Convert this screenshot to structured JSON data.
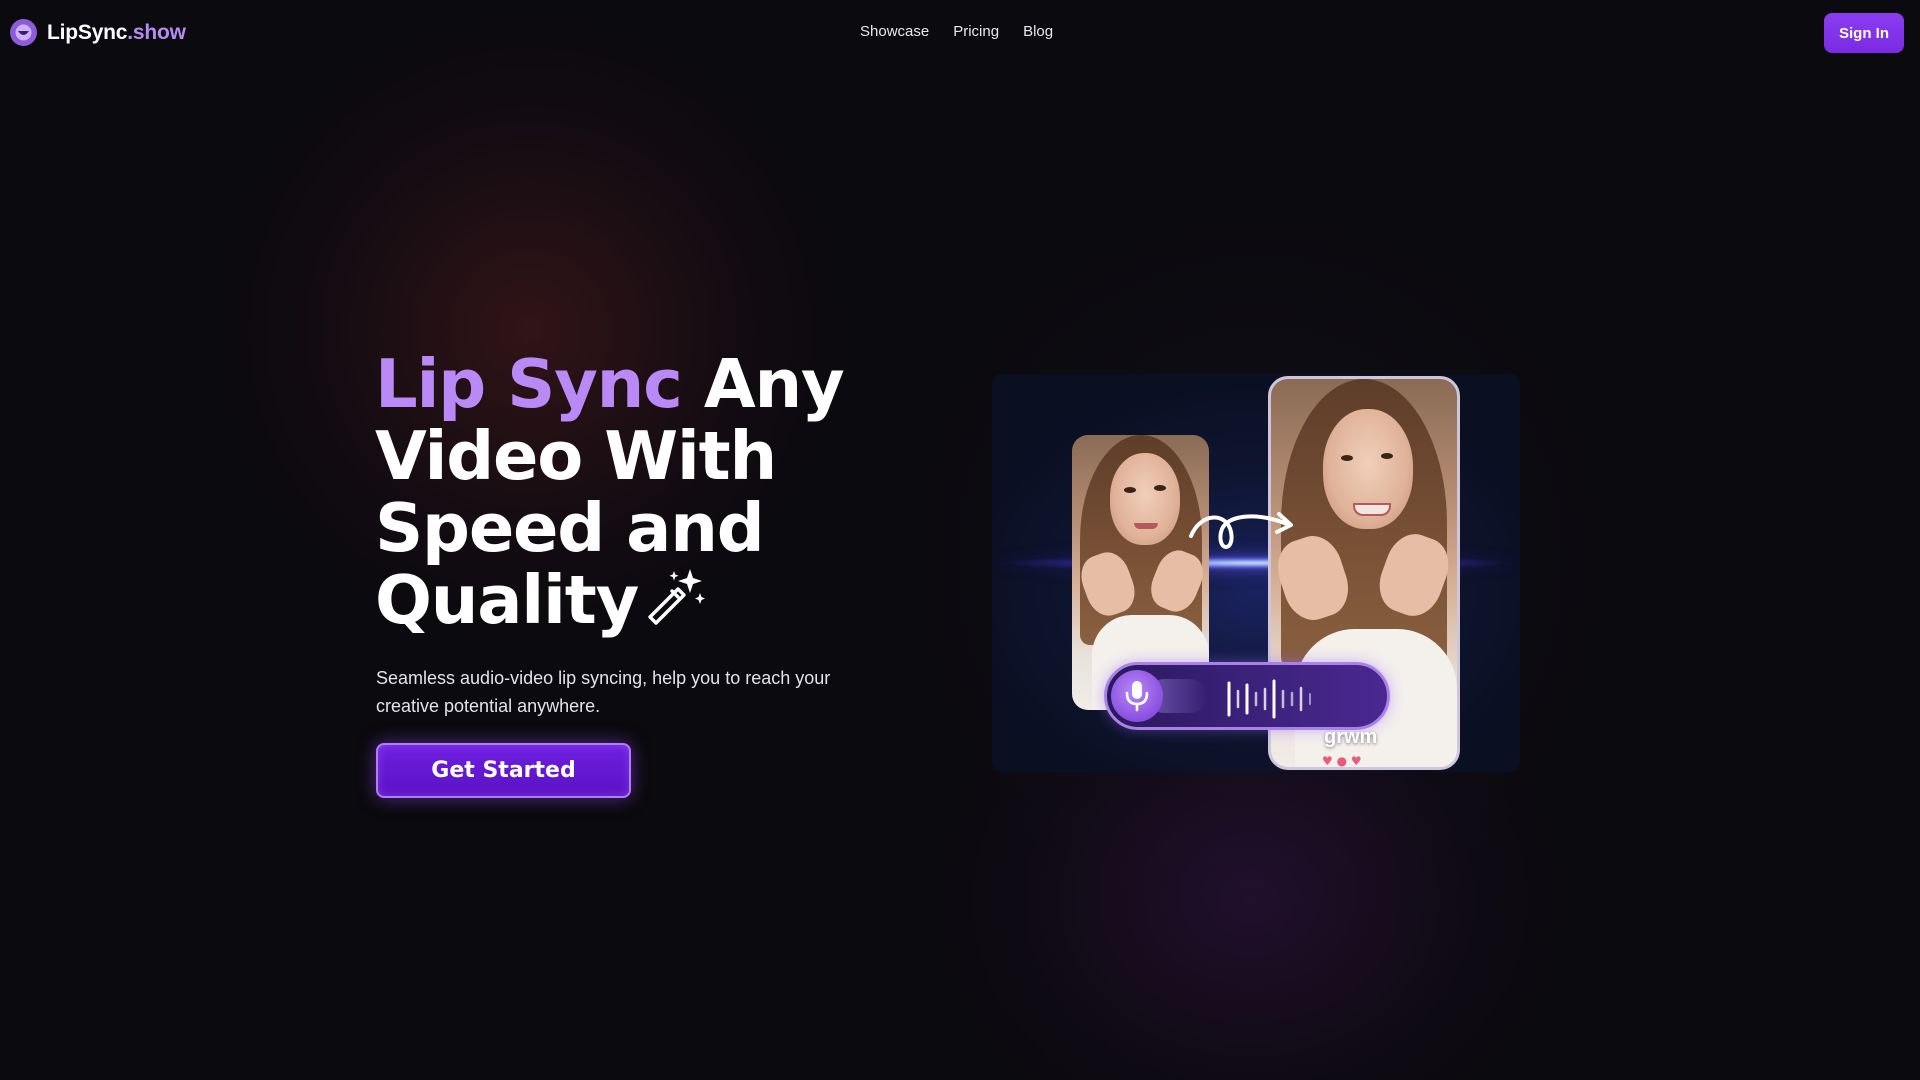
{
  "brand": {
    "name_main": "LipSync",
    "name_accent": ".show",
    "logo_icon": "smile-badge-icon"
  },
  "nav": {
    "links": [
      {
        "label": "Showcase"
      },
      {
        "label": "Pricing"
      },
      {
        "label": "Blog"
      }
    ],
    "signin_label": "Sign In"
  },
  "hero": {
    "title_highlight": "Lip Sync",
    "title_rest_line1": " Any",
    "title_line2": "Video With",
    "title_line3": "Speed and",
    "title_line4": "Quality",
    "title_icon": "magic-wand-icon",
    "subtitle": "Seamless audio-video lip syncing, help you to reach your creative potential anywhere.",
    "cta_label": "Get Started"
  },
  "media": {
    "caption": "grwm",
    "mic_icon": "microphone-icon",
    "arrow_icon": "curly-arrow-icon"
  },
  "colors": {
    "background": "#0b0a0e",
    "accent": "#b98af5",
    "button": "#7a2ae3"
  }
}
